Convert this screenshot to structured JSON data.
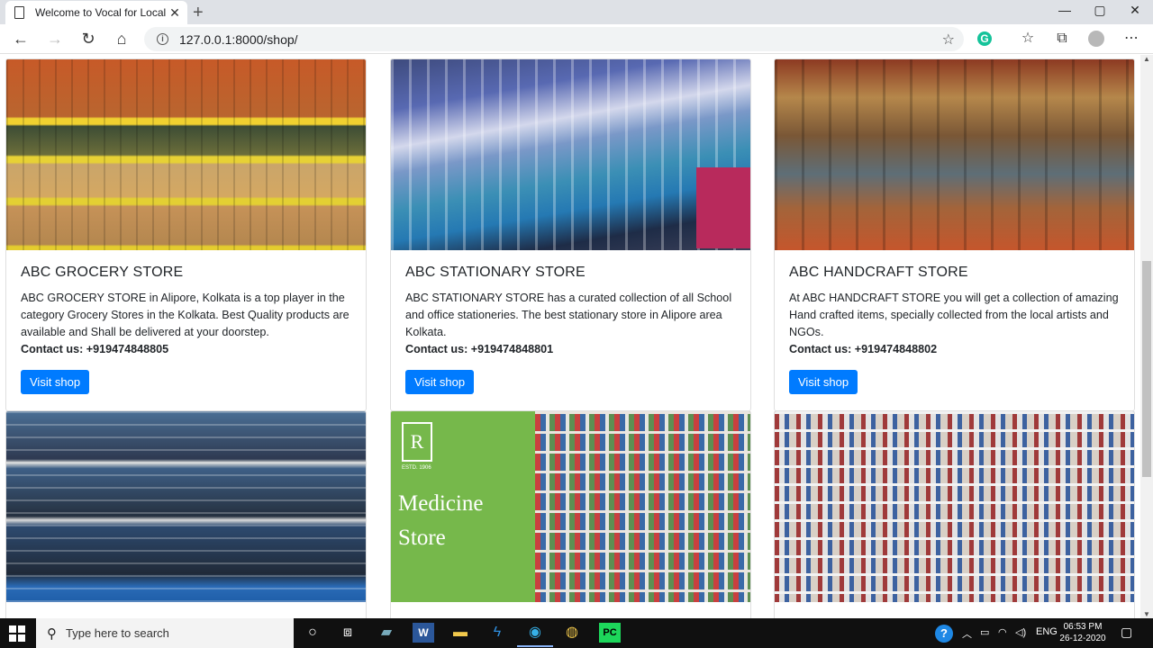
{
  "browser": {
    "tab_title": "Welcome to Vocal for Local Shop",
    "url": "127.0.0.1:8000/shop/"
  },
  "icons": {
    "doc": "document-icon",
    "close": "close-icon",
    "back": "back-arrow-icon",
    "forward": "forward-arrow-icon",
    "refresh": "refresh-icon",
    "home": "home-icon",
    "info": "info-icon",
    "star": "star-icon",
    "grammarly": "grammarly-icon",
    "favorites": "favorites-icon",
    "collections": "collections-icon",
    "profile": "profile-icon",
    "more": "more-icon"
  },
  "shops": [
    {
      "name": "ABC GROCERY STORE",
      "description": "ABC GROCERY STORE in Alipore, Kolkata is a top player in the category Grocery Stores in the Kolkata. Best Quality products are available and Shall be delivered at your doorstep.",
      "contact": "Contact us: +919474848805",
      "button": "Visit shop"
    },
    {
      "name": "ABC STATIONARY STORE",
      "description": "ABC STATIONARY STORE has a curated collection of all School and office stationeries. The best stationary store in Alipore area Kolkata.",
      "contact": "Contact us: +919474848801",
      "button": "Visit shop"
    },
    {
      "name": "ABC HANDCRAFT STORE",
      "description": "At ABC HANDCRAFT STORE you will get a collection of amazing Hand crafted items, specially collected from the local artists and NGOs.",
      "contact": "Contact us: +919474848802",
      "button": "Visit shop"
    }
  ],
  "medicine_banner": {
    "logo_letter": "R",
    "est": "ESTD. 1906",
    "line1": "Medicine",
    "line2": "Store"
  },
  "taskbar": {
    "search_placeholder": "Type here to search",
    "lang": "ENG",
    "time": "06:53 PM",
    "date": "26-12-2020"
  },
  "colors": {
    "primary_button": "#007bff",
    "medicine_green": "#76b84b"
  }
}
